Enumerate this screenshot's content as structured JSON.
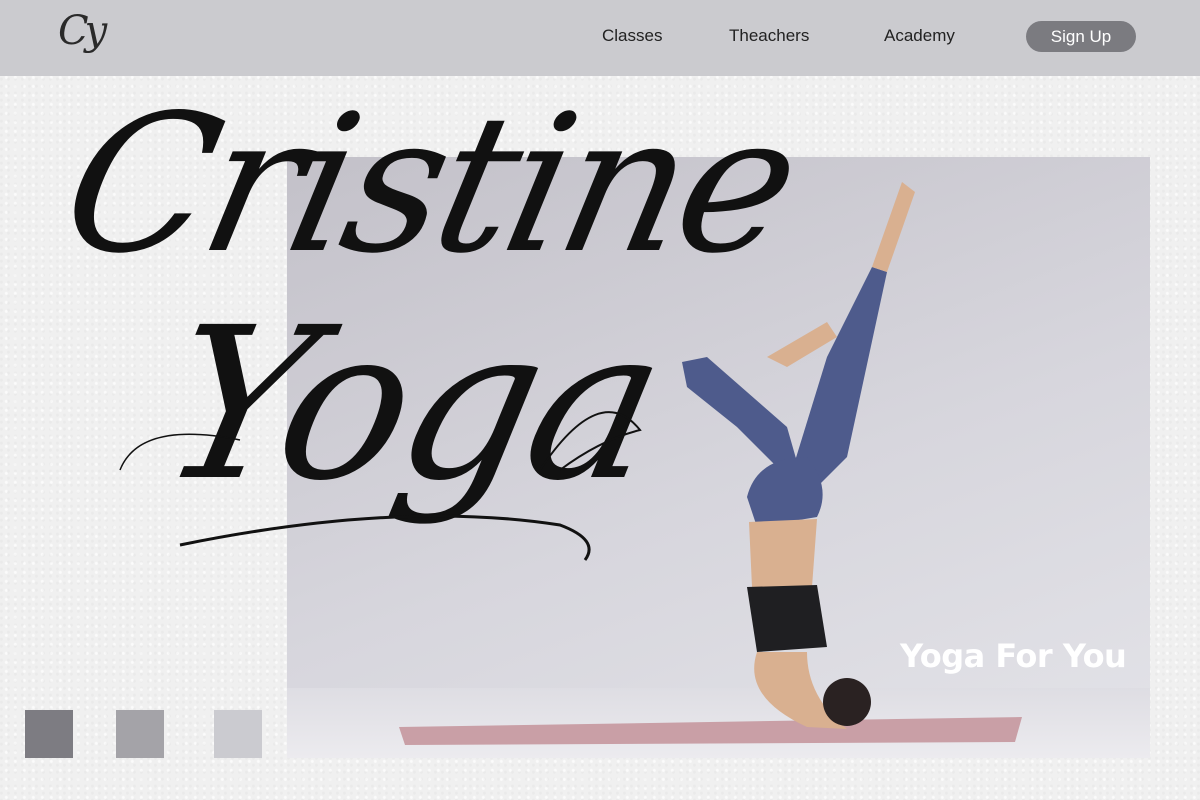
{
  "nav": {
    "logo": "Cy",
    "links": [
      "Classes",
      "Theachers",
      "Academy"
    ],
    "signup_label": "Sign Up"
  },
  "hero": {
    "title_line1": "Cristine",
    "title_line2": "Yoga",
    "tagline": "Yoga For You"
  },
  "colors": {
    "navbar_bg": "#cbcbcf",
    "signup_bg": "#7b7b80",
    "swatches": [
      "#7d7c82",
      "#a4a3a8",
      "#cbcbd0"
    ],
    "leggings": "#4e5b8c",
    "mat": "#c99fa6"
  }
}
